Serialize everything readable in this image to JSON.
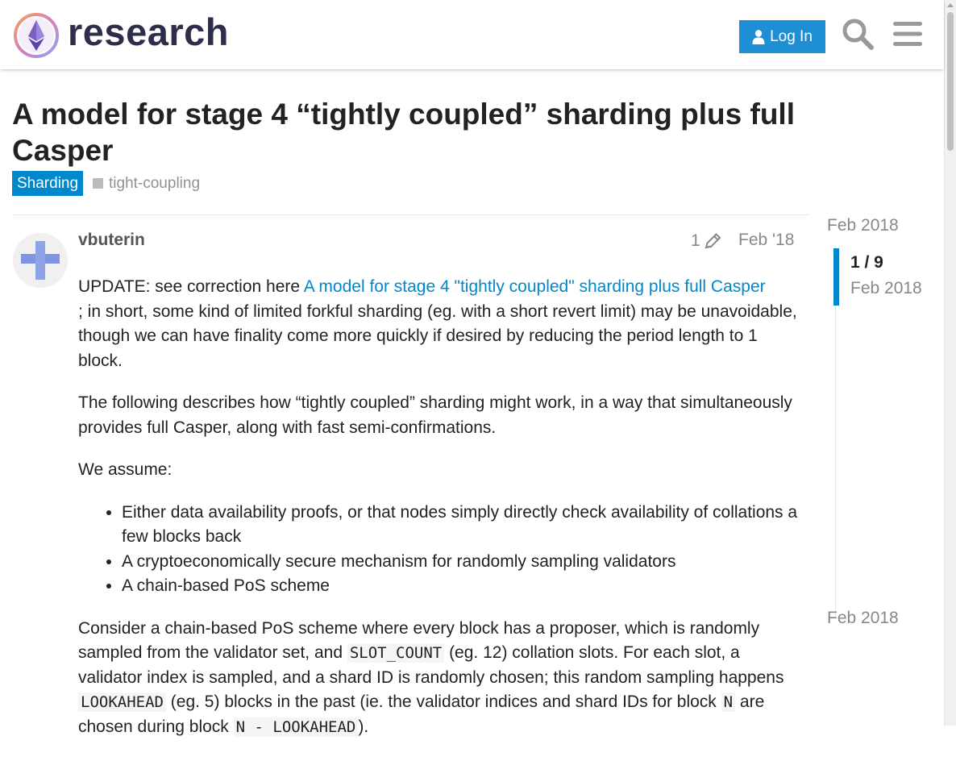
{
  "header": {
    "site_name": "research",
    "login_label": "Log In"
  },
  "topic": {
    "title": "A model for stage 4 “tightly coupled” sharding plus full Casper",
    "category": "Sharding",
    "tag": "tight-coupling"
  },
  "post": {
    "username": "vbuterin",
    "edit_count": "1",
    "date": "Feb '18",
    "update_prefix": "UPDATE: see correction here ",
    "update_link": "A model for stage 4 \"tightly coupled\" sharding plus full Casper",
    "update_suffix": "; in short, some kind of limited forkful sharding (eg. with a short revert limit) may be unavoidable, though we can have finality come more quickly if desired by reducing the period length to 1 block.",
    "para2": "The following describes how “tightly coupled” sharding might work, in a way that simultaneously provides full Casper, along with fast semi-confirmations.",
    "para3": "We assume:",
    "assumptions": [
      "Either data availability proofs, or that nodes simply directly check availability of collations a few blocks back",
      "A cryptoeconomically secure mechanism for randomly sampling validators",
      "A chain-based PoS scheme"
    ],
    "para4_a": "Consider a chain-based PoS scheme where every block has a proposer, which is randomly sampled from the validator set, and ",
    "para4_code1": "SLOT_COUNT",
    "para4_b": " (eg. 12) collation slots. For each slot, a validator index is sampled, and a shard ID is randomly chosen; this random sampling happens ",
    "para4_code2": "LOOKAHEAD",
    "para4_c": " (eg. 5) blocks in the past (ie. the validator indices and shard IDs for block ",
    "para4_code3": "N",
    "para4_d": " are chosen during block ",
    "para4_code4": "N - LOOKAHEAD",
    "para4_e": ")."
  },
  "timeline": {
    "top_date": "Feb 2018",
    "position": "1 / 9",
    "position_date": "Feb 2018",
    "bottom_date": "Feb 2018"
  },
  "colors": {
    "accent": "#0088cc",
    "login_button": "#1e8fd5",
    "muted_text": "#888888"
  },
  "icons": {
    "search": "search-icon",
    "menu": "hamburger-menu-icon",
    "user": "user-icon",
    "pencil": "pencil-icon"
  }
}
